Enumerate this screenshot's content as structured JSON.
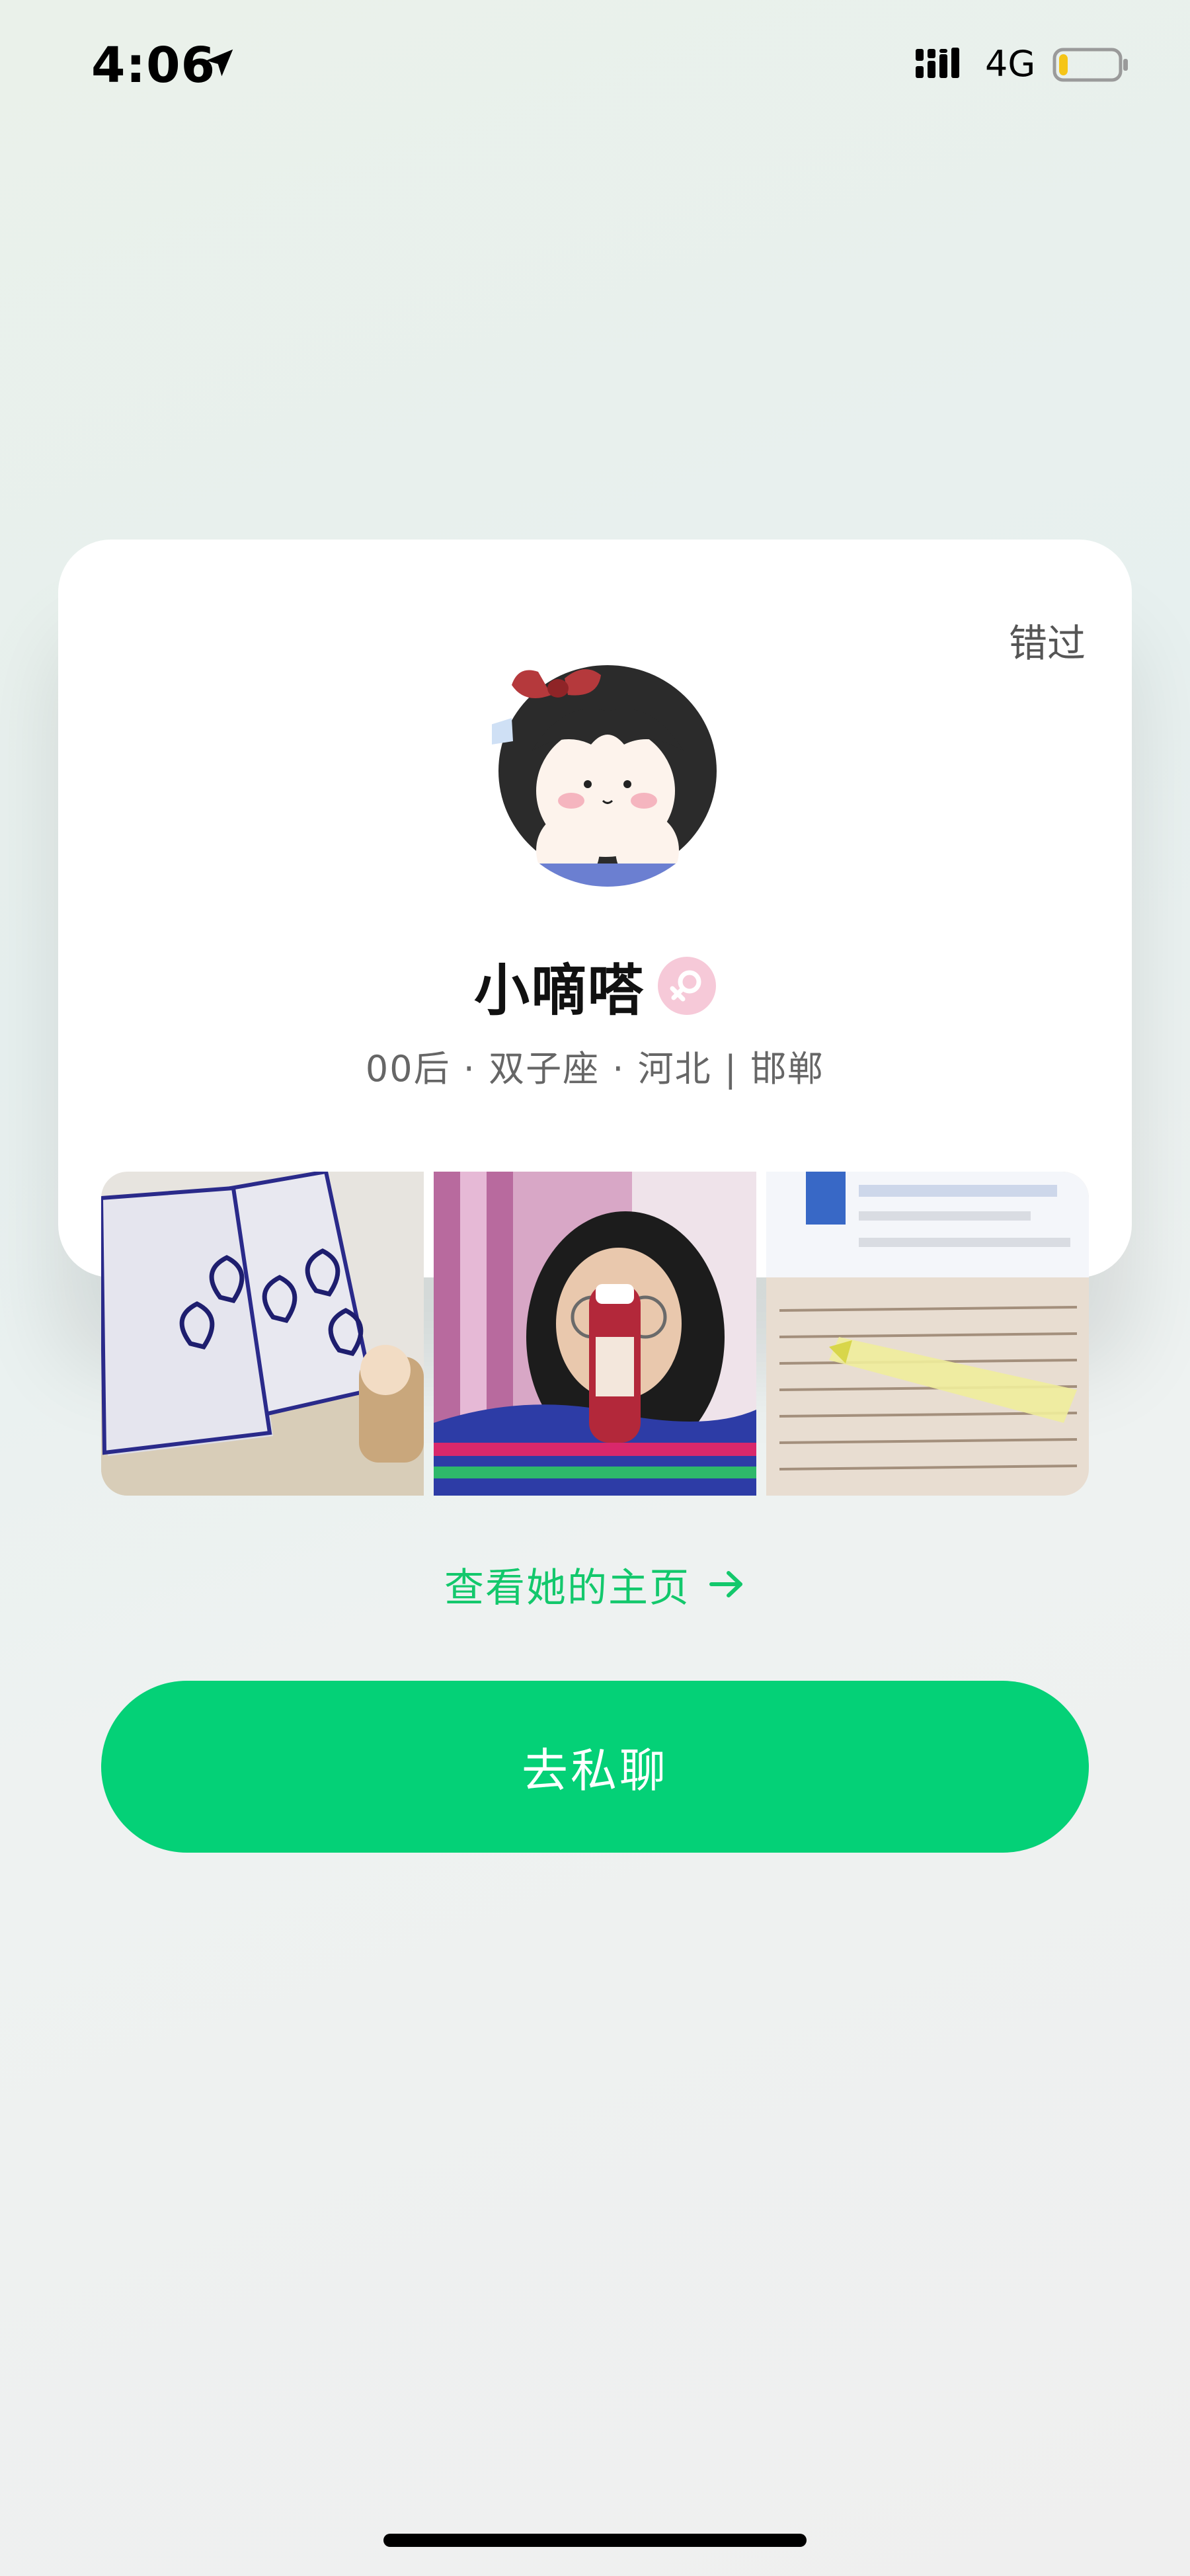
{
  "status_bar": {
    "time": "4:06",
    "network": "4G",
    "battery_level": 0.15,
    "battery_color": "#f5c518"
  },
  "card": {
    "skip_label": "错过",
    "profile": {
      "name": "小嘀嗒",
      "gender": "female",
      "gender_icon": "female-symbol-icon",
      "gender_color": "#f4a6c2",
      "subtitle": "00后 · 双子座 · 河北 | 邯郸"
    },
    "photos": [
      {
        "name": "photo-face-masks"
      },
      {
        "name": "photo-selfie-with-drink"
      },
      {
        "name": "photo-study-notes"
      }
    ],
    "profile_link_label": "查看她的主页",
    "profile_link_icon": "arrow-right-icon",
    "chat_button_label": "去私聊"
  },
  "colors": {
    "accent_green": "#04d177",
    "link_green": "#13c86c"
  }
}
